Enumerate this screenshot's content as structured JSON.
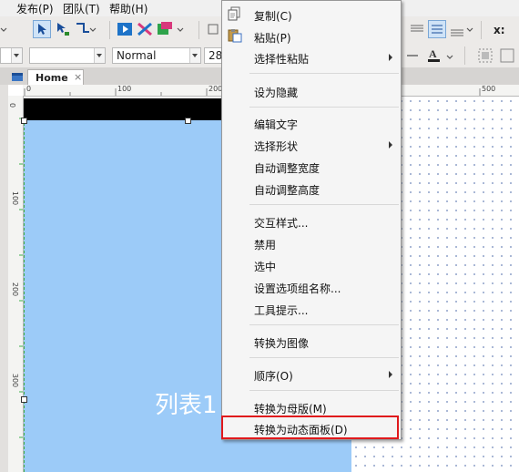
{
  "menubar": {
    "items": [
      {
        "label": "发布(P)"
      },
      {
        "label": "团队(T)"
      },
      {
        "label": "帮助(H)"
      }
    ]
  },
  "toolbar": {
    "style_combo_value": "Normal",
    "font_size_value": "28",
    "coord_label": "x:"
  },
  "tab": {
    "label": "Home",
    "close": "×"
  },
  "ruler": {
    "h_ticks": [
      "0",
      "100",
      "200",
      "500"
    ],
    "v_ticks": [
      "0",
      "100",
      "200",
      "300"
    ]
  },
  "canvas": {
    "widget_label": "列表1"
  },
  "context_menu": {
    "items": [
      {
        "label": "复制(C)"
      },
      {
        "label": "粘贴(P)"
      },
      {
        "label": "选择性粘贴"
      },
      {
        "label": "设为隐藏"
      },
      {
        "label": "编辑文字"
      },
      {
        "label": "选择形状"
      },
      {
        "label": "自动调整宽度"
      },
      {
        "label": "自动调整高度"
      },
      {
        "label": "交互样式..."
      },
      {
        "label": "禁用"
      },
      {
        "label": "选中"
      },
      {
        "label": "设置选项组名称..."
      },
      {
        "label": "工具提示..."
      },
      {
        "label": "转换为图像"
      },
      {
        "label": "顺序(O)"
      },
      {
        "label": "转换为母版(M)"
      },
      {
        "label": "转换为动态面板(D)"
      }
    ],
    "highlight_color": "#e0191c"
  },
  "colors": {
    "panel_blue": "#9ccbf8",
    "top_bar": "#000000",
    "menu_bg": "#f5f5f5"
  }
}
